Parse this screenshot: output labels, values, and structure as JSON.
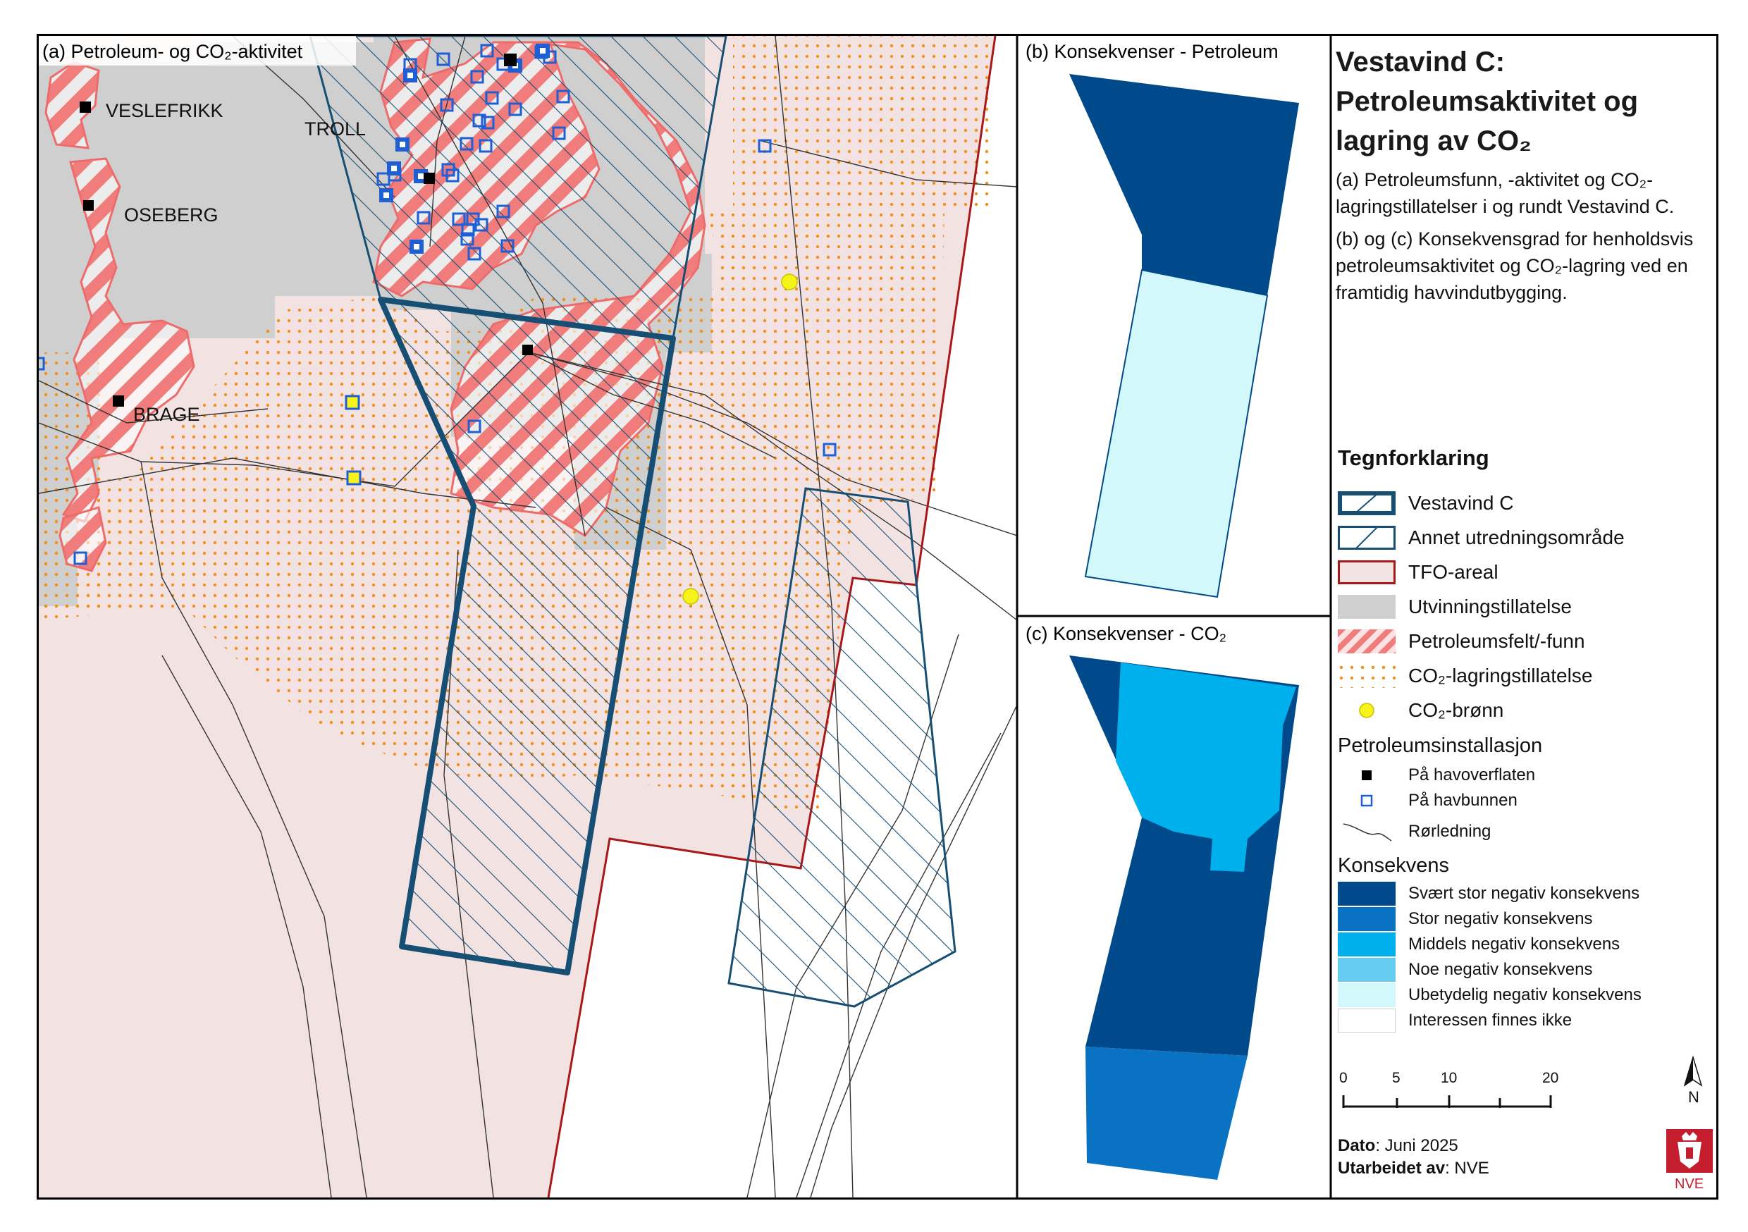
{
  "panels": {
    "a_label": "(a) Petroleum- og CO₂-aktivitet",
    "b_label": "(b) Konsekvenser - Petroleum",
    "c_label": "(c) Konsekvenser - CO₂"
  },
  "map_labels": {
    "veslefrikk": "VESLEFRIKK",
    "oseberg": "OSEBERG",
    "brage": "BRAGE",
    "troll": "TROLL"
  },
  "title": {
    "line1": "Vestavind C:",
    "line2": "Petroleumsaktivitet og",
    "line3": "lagring av CO₂"
  },
  "description": {
    "a": "(a) Petroleumsfunn, -aktivitet og CO₂-lagringstillatelser i og rundt Vestavind C.",
    "bc": "(b) og (c) Konsekvensgrad for henholdsvis petroleumsaktivitet og CO₂-lagring ved en framtidig havvindutbygging."
  },
  "legend": {
    "title": "Tegnforklaring",
    "items": [
      {
        "label": "Vestavind C",
        "symbol": "vestavind"
      },
      {
        "label": "Annet utredningsområde",
        "symbol": "annet"
      },
      {
        "label": "TFO-areal",
        "symbol": "tfo"
      },
      {
        "label": "Utvinningstillatelse",
        "symbol": "utvinning"
      },
      {
        "label": "Petroleumsfelt/-funn",
        "symbol": "petroleum"
      },
      {
        "label": "CO₂-lagringstillatelse",
        "symbol": "co2lagring"
      },
      {
        "label": "CO₂-brønn",
        "symbol": "co2bronn"
      }
    ],
    "installasjon_heading": "Petroleumsinstallasjon",
    "installasjon": [
      {
        "label": "På havoverflaten",
        "symbol": "black-square-icon"
      },
      {
        "label": "På havbunnen",
        "symbol": "blue-outline-square-icon"
      },
      {
        "label": "Rørledning",
        "symbol": "pipeline-line-icon"
      }
    ],
    "konsekvens_heading": "Konsekvens",
    "konsekvens": [
      {
        "label": "Svært stor negativ konsekvens",
        "color": "#004a8c"
      },
      {
        "label": "Stor negativ konsekvens",
        "color": "#0a72c2"
      },
      {
        "label": "Middels negativ konsekvens",
        "color": "#00b0ec"
      },
      {
        "label": "Noe negativ konsekvens",
        "color": "#66ccf0"
      },
      {
        "label": "Ubetydelig negativ konsekvens",
        "color": "#d2f8fb"
      },
      {
        "label": "Interessen finnes ikke",
        "color": "#ffffff"
      }
    ]
  },
  "scalebar": {
    "ticks": [
      "0",
      "5",
      "10",
      "20 km"
    ]
  },
  "north_arrow": "N",
  "meta": {
    "dato_label": "Dato",
    "dato_value": ": Juni 2025",
    "utarbeidet_label": "Utarbeidet av",
    "utarbeidet_value": ": NVE"
  },
  "logo_text": "NVE",
  "colors": {
    "vestavind": "#174f74",
    "tfo": "#a81818",
    "tfo_fill": "#f3e2e2",
    "utvinning": "#cfcfcf",
    "petroleum": "#f08080",
    "co2lagring": "#f0901e",
    "co2bronn": "#f5f31a",
    "seabed": "#1f5fd6"
  }
}
